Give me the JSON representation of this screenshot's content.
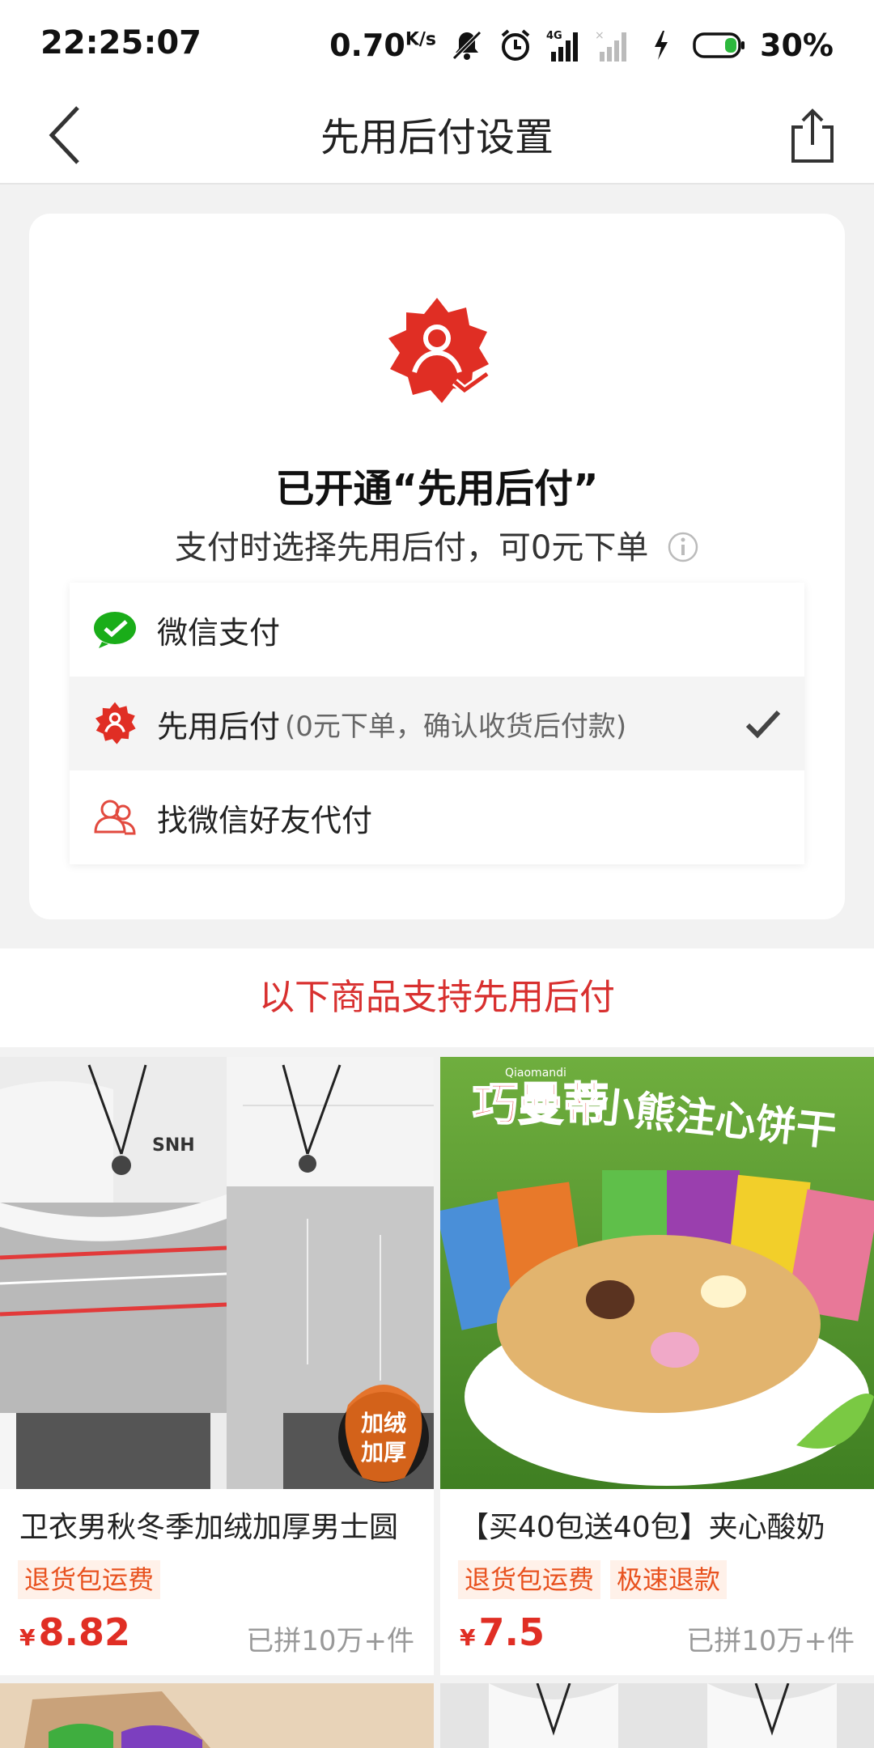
{
  "status_bar": {
    "time": "22:25:07",
    "speed": "0.70",
    "speed_unit": "K/s",
    "battery": "30%",
    "icons": [
      "mute-icon",
      "alarm-icon",
      "signal-4g-icon",
      "signal-empty-icon",
      "charging-icon",
      "battery-icon"
    ]
  },
  "nav": {
    "title": "先用后付设置",
    "back_icon": "back-chevron-icon",
    "share_icon": "share-icon"
  },
  "card": {
    "badge_icon": "pay-later-badge-icon",
    "title": "已开通“先用后付”",
    "subtitle": "支付时选择先用后付，可0元下单",
    "info_icon": "info-icon",
    "payment_options": [
      {
        "label": "微信支付",
        "note": "",
        "icon": "wechat-pay-icon",
        "selected": false
      },
      {
        "label": "先用后付",
        "note": "(0元下单，确认收货后付款)",
        "icon": "pay-later-icon",
        "selected": true
      },
      {
        "label": "找微信好友代付",
        "note": "",
        "icon": "friends-pay-icon",
        "selected": false
      }
    ]
  },
  "section": {
    "header": "以下商品支持先用后付"
  },
  "products": [
    {
      "title": "卫衣男秋冬季加绒加厚男士圆",
      "tags": [
        "退货包运费"
      ],
      "currency": "¥",
      "price": "8.82",
      "sold": "已拼10万+件",
      "image_badge": "加绒 加厚"
    },
    {
      "title": "【买40包送40包】夹心酸奶",
      "tags": [
        "退货包运费",
        "极速退款"
      ],
      "currency": "¥",
      "price": "7.5",
      "sold": "已拼10万+件",
      "image_text_brand": "巧曼蒂",
      "image_text_slogan": "小熊注心饼干",
      "image_text_latin": "Qiaomandi"
    }
  ],
  "colors": {
    "brand_red": "#e02e24",
    "section_red": "#d8302f",
    "tag_orange": "#e8521f",
    "wechat_green": "#1aad19"
  }
}
